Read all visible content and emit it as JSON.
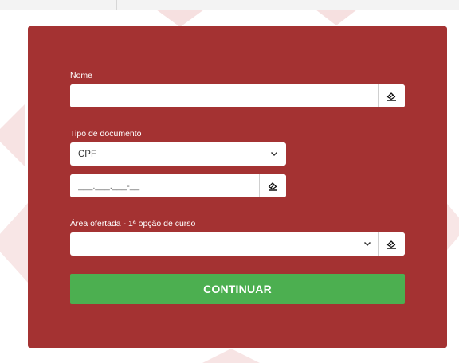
{
  "form": {
    "nome": {
      "label": "Nome",
      "value": "",
      "clear_icon": "eraser-icon"
    },
    "tipo_documento": {
      "label": "Tipo de documento",
      "selected": "CPF",
      "dropdown_icon": "chevron-down-icon"
    },
    "documento": {
      "value": "",
      "placeholder": "___.___.___-__",
      "clear_icon": "eraser-icon"
    },
    "area_ofertada": {
      "label": "Área ofertada - 1ª opção de curso",
      "selected": "",
      "dropdown_icon": "chevron-down-icon",
      "clear_icon": "eraser-icon"
    },
    "continue_label": "CONTINUAR"
  },
  "colors": {
    "card_background": "#a43232",
    "continue_button": "#4caf50",
    "label_text": "#ffffff"
  }
}
